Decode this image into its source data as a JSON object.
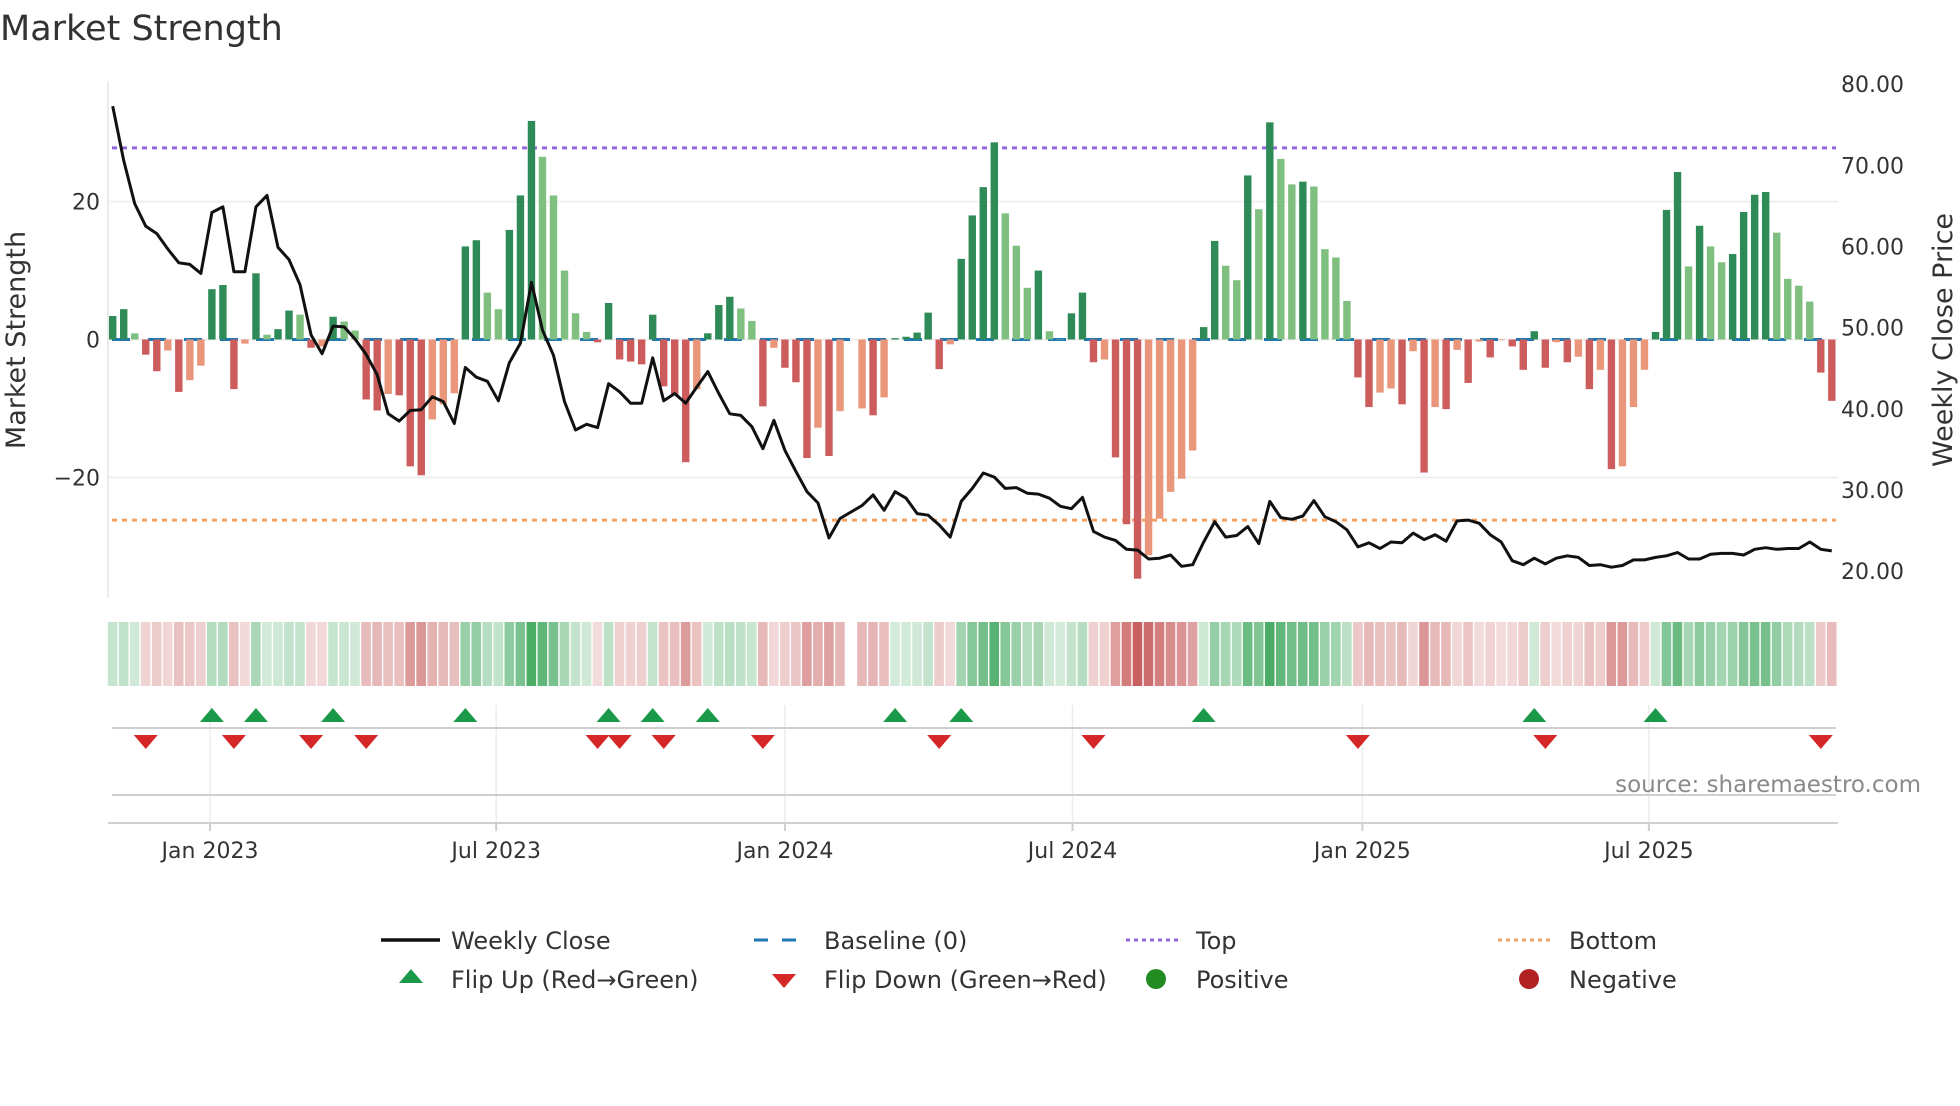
{
  "title": "Market Strength",
  "source": "source: sharemaestro.com",
  "colors": {
    "pos_strong": "#2e8b57",
    "pos_weak": "#7fbf7f",
    "neg_strong": "#cd5c5c",
    "neg_weak": "#e9967a",
    "close_line": "#111111",
    "baseline": "#1f77b4",
    "top": "#9467dd",
    "bottom": "#f4a261",
    "flip_up": "#1a9a48",
    "flip_down": "#d62728",
    "legend_positive": "#228b22",
    "legend_negative": "#b22222"
  },
  "legend": {
    "weekly_close": "Weekly Close",
    "baseline": "Baseline (0)",
    "top": "Top",
    "bottom": "Bottom",
    "flip_up": "Flip Up (Red→Green)",
    "flip_down": "Flip Down (Green→Red)",
    "positive": "Positive",
    "negative": "Negative"
  },
  "chart_data": {
    "type": "bar+line",
    "title": "Market Strength",
    "ylabel_left": "Market Strength",
    "ylabel_right": "Weekly Close Price",
    "ylim_left": [
      -37.5,
      37.5
    ],
    "ylim_right": [
      16.7,
      80.4
    ],
    "left_ticks": [
      {
        "value": 20,
        "label": "20"
      },
      {
        "value": 0,
        "label": "0"
      },
      {
        "value": -20,
        "label": "−20"
      }
    ],
    "right_ticks": [
      {
        "value": 80,
        "label": "80.00"
      },
      {
        "value": 70,
        "label": "70.00"
      },
      {
        "value": 60,
        "label": "60.00"
      },
      {
        "value": 50,
        "label": "50.00"
      },
      {
        "value": 40,
        "label": "40.00"
      },
      {
        "value": 30,
        "label": "30.00"
      },
      {
        "value": 20,
        "label": "20.00"
      }
    ],
    "x_ticks": [
      {
        "week_index": 8.83,
        "label": "Jan 2023"
      },
      {
        "week_index": 34.8,
        "label": "Jul 2023"
      },
      {
        "week_index": 61.0,
        "label": "Jan 2024"
      },
      {
        "week_index": 87.1,
        "label": "Jul 2024"
      },
      {
        "week_index": 113.4,
        "label": "Jan 2025"
      },
      {
        "week_index": 139.4,
        "label": "Jul 2025"
      }
    ],
    "top_level": 27.8,
    "bottom_level": -26.2,
    "baseline_level": 0,
    "strength": [
      3.4,
      4.4,
      0.9,
      -2.2,
      -4.6,
      -1.6,
      -7.6,
      -5.9,
      -3.8,
      7.3,
      7.9,
      -7.2,
      -0.6,
      9.6,
      0.7,
      1.5,
      4.2,
      3.6,
      -1.2,
      -1.0,
      3.3,
      2.6,
      1.3,
      -8.7,
      -10.3,
      -7.9,
      -8.1,
      -18.4,
      -19.7,
      -11.6,
      -9.4,
      -7.8,
      13.5,
      14.4,
      6.8,
      4.4,
      15.9,
      20.9,
      31.7,
      26.5,
      20.9,
      10,
      3.8,
      1.1,
      -0.4,
      5.3,
      -2.9,
      -3.2,
      -3.6,
      3.6,
      -6.8,
      -8.1,
      -17.8,
      -7.2,
      0.9,
      5,
      6.2,
      4.5,
      2.7,
      -9.7,
      -1.2,
      -4.1,
      -6.2,
      -17.2,
      -12.8,
      -16.9,
      -10.4,
      null,
      -10,
      -11,
      -8.4,
      0.2,
      0.4,
      1,
      3.9,
      -4.3,
      -0.7,
      11.7,
      18,
      22.1,
      28.6,
      18.3,
      13.6,
      7.5,
      10,
      1.2,
      0,
      3.8,
      6.8,
      -3.3,
      -2.9,
      -17.1,
      -26.8,
      -34.7,
      -31.3,
      -26,
      -22.1,
      -20.2,
      -16.1,
      1.8,
      14.3,
      10.7,
      8.6,
      23.8,
      18.9,
      31.5,
      26.2,
      22.5,
      22.9,
      22.2,
      13.1,
      11.9,
      5.6,
      -5.5,
      -9.8,
      -7.7,
      -7.1,
      -9.4,
      -1.7,
      -19.3,
      -9.8,
      -10.1,
      -1.5,
      -6.3,
      -0.3,
      -2.6,
      -0.1,
      -1,
      -4.4,
      1.2,
      -4.1,
      -0.4,
      -3.3,
      -2.5,
      -7.2,
      -4.4,
      -18.8,
      -18.4,
      -9.8,
      -4.4,
      1.1,
      18.8,
      24.3,
      10.6,
      16.5,
      13.5,
      11.2,
      12.4,
      18.5,
      21,
      21.4,
      15.5,
      8.8,
      7.8,
      5.5,
      -4.8,
      -8.9
    ],
    "close": [
      77.3,
      70.6,
      65.3,
      62.5,
      61.6,
      59.7,
      58,
      57.8,
      56.7,
      64.2,
      64.9,
      56.9,
      56.9,
      64.9,
      66.3,
      59.9,
      58.4,
      55.3,
      49.1,
      46.8,
      50.2,
      50.1,
      48.6,
      46.7,
      44.2,
      39.4,
      38.5,
      39.8,
      39.9,
      41.5,
      40.9,
      38.2,
      45.1,
      43.9,
      43.4,
      41,
      45.7,
      48.1,
      55.6,
      49.7,
      46.6,
      40.9,
      37.4,
      38.1,
      37.7,
      43.1,
      42.1,
      40.7,
      40.7,
      46.3,
      41,
      41.9,
      40.7,
      42.7,
      44.6,
      41.9,
      39.4,
      39.2,
      37.8,
      35.1,
      38.6,
      34.9,
      32.3,
      29.8,
      28.4,
      24.1,
      26.5,
      27.3,
      28.1,
      29.4,
      27.5,
      29.8,
      29,
      27.1,
      26.9,
      25.7,
      24.2,
      28.6,
      30.2,
      32.1,
      31.6,
      30.2,
      30.3,
      29.6,
      29.5,
      29,
      28,
      27.7,
      29.1,
      24.9,
      24.2,
      23.8,
      22.7,
      22.6,
      21.5,
      21.6,
      22,
      20.6,
      20.8,
      23.6,
      26.1,
      24.2,
      24.4,
      25.5,
      23.4,
      28.6,
      26.6,
      26.4,
      26.8,
      28.7,
      26.7,
      26.1,
      25.1,
      23,
      23.5,
      22.8,
      23.6,
      23.5,
      24.7,
      23.9,
      24.5,
      23.7,
      26.2,
      26.3,
      25.9,
      24.5,
      23.6,
      21.3,
      20.8,
      21.6,
      20.9,
      21.6,
      21.9,
      21.7,
      20.7,
      20.8,
      20.5,
      20.7,
      21.4,
      21.4,
      21.7,
      21.9,
      22.3,
      21.5,
      21.5,
      22.1,
      22.2,
      22.2,
      22,
      22.7,
      22.9,
      22.7,
      22.8,
      22.8,
      23.6,
      22.7,
      22.5
    ],
    "flip_up_week_indices": [
      9,
      13,
      20,
      32,
      45,
      49,
      54,
      71,
      77,
      99,
      129,
      140
    ],
    "flip_down_week_indices": [
      3,
      11,
      18,
      23,
      44,
      46,
      50,
      59,
      75,
      89,
      113,
      130,
      155
    ],
    "legend_position": "bottom-center"
  }
}
